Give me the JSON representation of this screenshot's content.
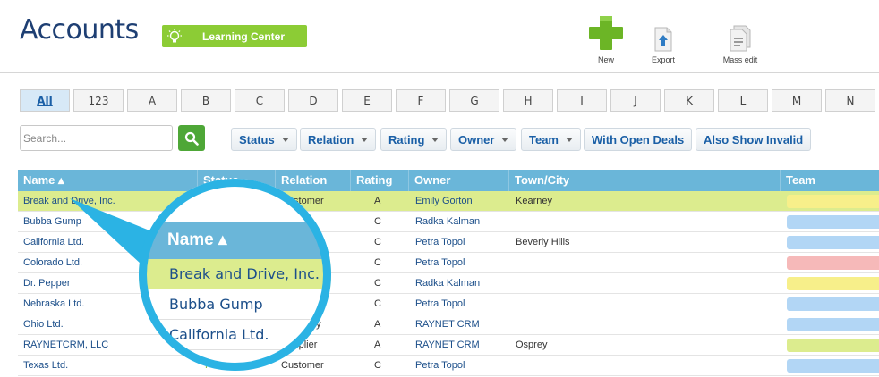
{
  "header": {
    "title": "Accounts",
    "learning_center": "Learning Center",
    "tools": [
      {
        "label": "New",
        "icon": "plus-icon"
      },
      {
        "label": "Export",
        "icon": "export-icon"
      },
      {
        "label": "Mass edit",
        "icon": "mass-edit-icon"
      }
    ]
  },
  "letters": [
    "All",
    "123",
    "A",
    "B",
    "C",
    "D",
    "E",
    "F",
    "G",
    "H",
    "I",
    "J",
    "K",
    "L",
    "M",
    "N"
  ],
  "search": {
    "placeholder": "Search..."
  },
  "filters": [
    {
      "label": "Status",
      "dropdown": true
    },
    {
      "label": "Relation",
      "dropdown": true
    },
    {
      "label": "Rating",
      "dropdown": true
    },
    {
      "label": "Owner",
      "dropdown": true
    },
    {
      "label": "Team",
      "dropdown": true
    },
    {
      "label": "With Open Deals",
      "dropdown": false
    },
    {
      "label": "Also Show Invalid",
      "dropdown": false
    }
  ],
  "table": {
    "columns": [
      "Name ▴",
      "Status",
      "Relation",
      "Rating",
      "Owner",
      "Town/City",
      "Team"
    ],
    "rows": [
      {
        "name": "Break and Drive, Inc.",
        "status": "",
        "relation": "Customer",
        "rating": "A",
        "owner": "Emily Gorton",
        "town": "Kearney",
        "team_color": "#f7ef8a",
        "selected": true
      },
      {
        "name": "Bubba Gump",
        "status": "",
        "relation": "omer",
        "rating": "C",
        "owner": "Radka Kalman",
        "town": "",
        "team_color": "#b2d6f5",
        "selected": false
      },
      {
        "name": "California Ltd.",
        "status": "",
        "relation": "lier",
        "rating": "C",
        "owner": "Petra Topol",
        "town": "Beverly Hills",
        "team_color": "#b2d6f5",
        "selected": false
      },
      {
        "name": "Colorado Ltd.",
        "status": "",
        "relation": "",
        "rating": "C",
        "owner": "Petra Topol",
        "town": "",
        "team_color": "#f6b9b9",
        "selected": false
      },
      {
        "name": "Dr. Pepper",
        "status": "",
        "relation": "r",
        "rating": "C",
        "owner": "Radka Kalman",
        "town": "",
        "team_color": "#f7ef8a",
        "selected": false
      },
      {
        "name": "Nebraska Ltd.",
        "status": "",
        "relation": "r",
        "rating": "C",
        "owner": "Petra Topol",
        "town": "",
        "team_color": "#b2d6f5",
        "selected": false
      },
      {
        "name": "Ohio Ltd.",
        "status": "",
        "relation": "company",
        "rating": "A",
        "owner": "RAYNET CRM",
        "town": "",
        "team_color": "#b2d6f5",
        "selected": false
      },
      {
        "name": "RAYNETCRM, LLC",
        "status": "",
        "relation": "Supplier",
        "rating": "A",
        "owner": "RAYNET CRM",
        "town": "Osprey",
        "team_color": "#dcec8e",
        "selected": false
      },
      {
        "name": "Texas Ltd.",
        "status": "Potential",
        "relation": "Customer",
        "rating": "C",
        "owner": "Petra Topol",
        "town": "",
        "team_color": "#b2d6f5",
        "selected": false
      }
    ]
  },
  "magnifier": {
    "header": "Name ▴",
    "rows": [
      "Break and Drive, Inc.",
      "Bubba Gump",
      "California Ltd."
    ]
  },
  "colors": {
    "accent": "#6ab6d9",
    "selected": "#dcec8e",
    "brand_green": "#8ccc35",
    "ring": "#2bb3e4"
  }
}
